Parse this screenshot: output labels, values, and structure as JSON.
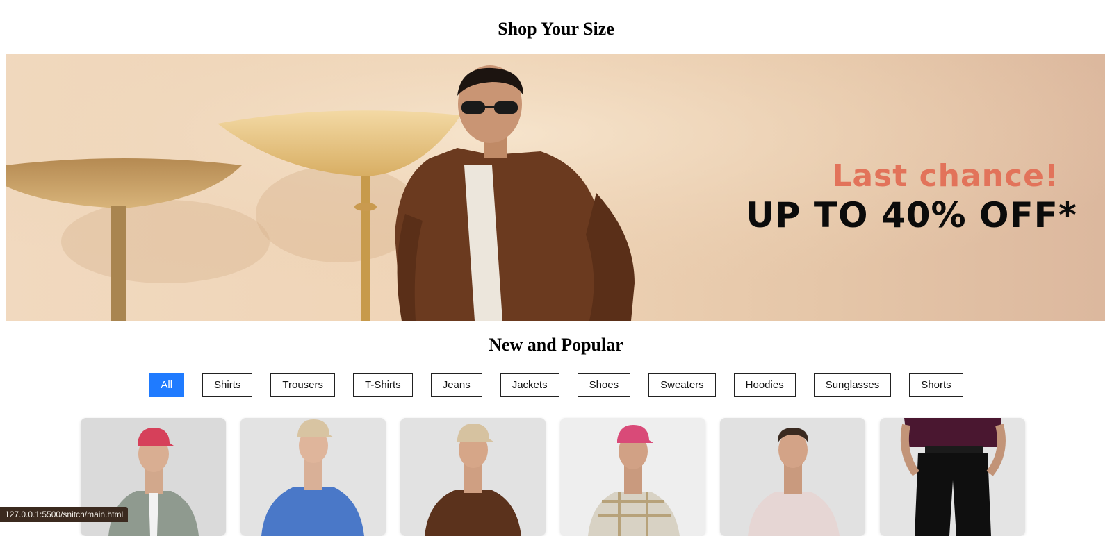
{
  "sections": {
    "shop_size_title": "Shop Your Size",
    "new_popular_title": "New and Popular"
  },
  "banner": {
    "line1": "Last chance!",
    "line2": "UP TO 40% OFF*"
  },
  "filters": [
    "All",
    "Shirts",
    "Trousers",
    "T-Shirts",
    "Jeans",
    "Jackets",
    "Shoes",
    "Sweaters",
    "Hoodies",
    "Sunglasses",
    "Shorts"
  ],
  "active_filter": "All",
  "colors": {
    "accent": "#1f7bff",
    "promo": "#e2735a"
  },
  "status_bar": "127.0.0.1:5500/snitch/main.html"
}
